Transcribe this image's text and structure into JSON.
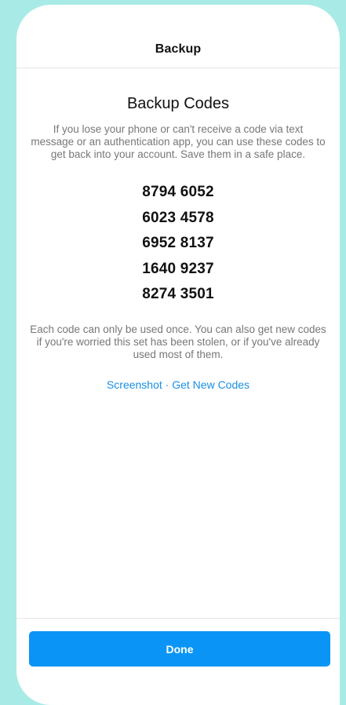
{
  "header": {
    "title": "Backup"
  },
  "main": {
    "section_title": "Backup Codes",
    "intro": "If you lose your phone or can't receive a code via text message or an authentication app, you can use these codes to get back into your account. Save them in a safe place.",
    "codes": [
      "8794 6052",
      "6023 4578",
      "6952 8137",
      "1640 9237",
      "8274 3501"
    ],
    "note": "Each code can only be used once. You can also get new codes if you're worried this set has been stolen, or if you've already used most of them.",
    "links": {
      "screenshot": "Screenshot",
      "separator": " · ",
      "get_new_codes": "Get New Codes"
    }
  },
  "footer": {
    "done_label": "Done"
  },
  "colors": {
    "background": "#a8ebe6",
    "accent": "#0a95f6",
    "link": "#1a8fe3"
  }
}
